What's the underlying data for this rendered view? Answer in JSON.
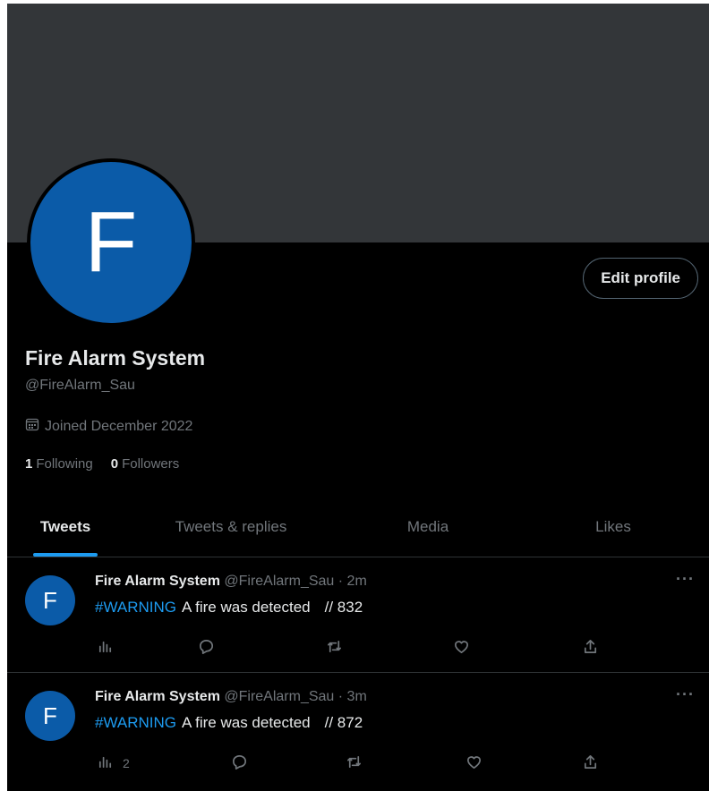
{
  "profile": {
    "avatar_letter": "F",
    "edit_label": "Edit profile",
    "name": "Fire Alarm System",
    "handle": "@FireAlarm_Sau",
    "joined": "Joined December 2022",
    "following_count": "1",
    "following_label": "Following",
    "followers_count": "0",
    "followers_label": "Followers"
  },
  "tabs": [
    {
      "label": "Tweets",
      "active": true
    },
    {
      "label": "Tweets & replies",
      "active": false
    },
    {
      "label": "Media",
      "active": false
    },
    {
      "label": "Likes",
      "active": false
    }
  ],
  "tweets": [
    {
      "avatar_letter": "F",
      "name": "Fire Alarm System",
      "meta": "@FireAlarm_Sau · 2m",
      "hashtag": "#WARNING",
      "text": "A fire was detected",
      "code": "// 832",
      "views": "",
      "more": "···"
    },
    {
      "avatar_letter": "F",
      "name": "Fire Alarm System",
      "meta": "@FireAlarm_Sau · 3m",
      "hashtag": "#WARNING",
      "text": "A fire was detected",
      "code": "// 872",
      "views": "2",
      "more": "···"
    }
  ],
  "icons": {
    "analytics": "analytics-icon",
    "reply": "reply-icon",
    "retweet": "retweet-icon",
    "like": "like-icon",
    "share": "share-icon",
    "calendar": "calendar-icon"
  },
  "colors": {
    "accent": "#1d9bf0",
    "avatar": "#0b5ba8",
    "banner": "#333639"
  }
}
